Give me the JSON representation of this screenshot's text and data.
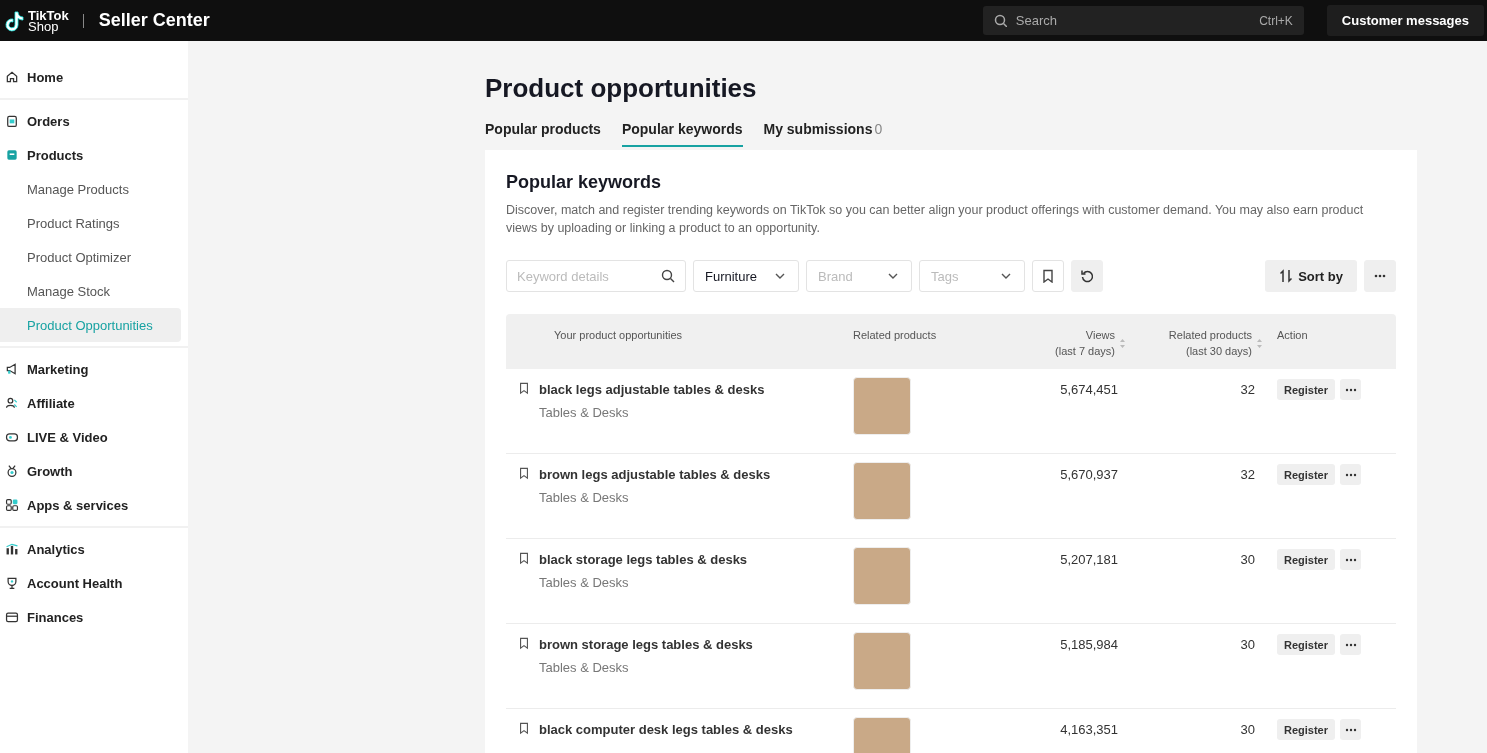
{
  "topbar": {
    "logo_line1": "TikTok",
    "logo_line2": "Shop",
    "title": "Seller Center",
    "search": {
      "placeholder": "Search",
      "shortcut": "Ctrl+K"
    },
    "button": "Customer messages"
  },
  "sidebar": {
    "sections": [
      [
        {
          "label": "Home",
          "selected": false
        }
      ],
      [
        {
          "label": "Orders",
          "selected": false
        },
        {
          "label": "Products",
          "selected": false,
          "children": [
            {
              "label": "Manage Products",
              "selected": false
            },
            {
              "label": "Product Ratings",
              "selected": false
            },
            {
              "label": "Product Optimizer",
              "selected": false
            },
            {
              "label": "Manage Stock",
              "selected": false
            },
            {
              "label": "Product Opportunities",
              "selected": true
            }
          ]
        }
      ],
      [
        {
          "label": "Marketing",
          "selected": false
        },
        {
          "label": "Affiliate",
          "selected": false
        },
        {
          "label": "LIVE & Video",
          "selected": false
        },
        {
          "label": "Growth",
          "selected": false
        },
        {
          "label": "Apps & services",
          "selected": false
        }
      ],
      [
        {
          "label": "Analytics",
          "selected": false
        },
        {
          "label": "Account Health",
          "selected": false
        },
        {
          "label": "Finances",
          "selected": false
        }
      ]
    ]
  },
  "page": {
    "title": "Product opportunities",
    "tabs": [
      {
        "label": "Popular products",
        "selected": false
      },
      {
        "label": "Popular keywords",
        "selected": true
      },
      {
        "label": "My submissions",
        "count": "0",
        "selected": false
      }
    ],
    "card": {
      "title": "Popular keywords",
      "description": "Discover, match and register trending keywords on TikTok so you can better align your product offerings with customer demand. You may also earn product views by uploading or linking a product to an opportunity.",
      "keyword_field": {
        "placeholder": "Keyword details"
      },
      "dropdowns": [
        {
          "value": "Furniture"
        },
        {
          "placeholder": "Brand"
        },
        {
          "placeholder": "Tags"
        }
      ],
      "sort_button": "Sort by",
      "columns": [
        {
          "label": "Your product opportunities",
          "sortable": false
        },
        {
          "label": "Related products",
          "sortable": false
        },
        {
          "label": "Views",
          "sublabel": "(last 7 days)",
          "sortable": true
        },
        {
          "label": "Related products",
          "sublabel": "(last 30 days)",
          "sortable": true
        },
        {
          "label": "Action",
          "sortable": false
        }
      ],
      "rows": [
        {
          "keyword": "black legs adjustable tables & desks",
          "category": "Tables & Desks",
          "views": "5,674,451",
          "related": "32",
          "action": "Register"
        },
        {
          "keyword": "brown legs adjustable tables & desks",
          "category": "Tables & Desks",
          "views": "5,670,937",
          "related": "32",
          "action": "Register"
        },
        {
          "keyword": "black storage legs tables & desks",
          "category": "Tables & Desks",
          "views": "5,207,181",
          "related": "30",
          "action": "Register"
        },
        {
          "keyword": "brown storage legs tables & desks",
          "category": "Tables & Desks",
          "views": "5,185,984",
          "related": "30",
          "action": "Register"
        },
        {
          "keyword": "black computer desk legs tables & desks",
          "views": "4,163,351",
          "related": "30",
          "action": "Register"
        }
      ]
    }
  }
}
